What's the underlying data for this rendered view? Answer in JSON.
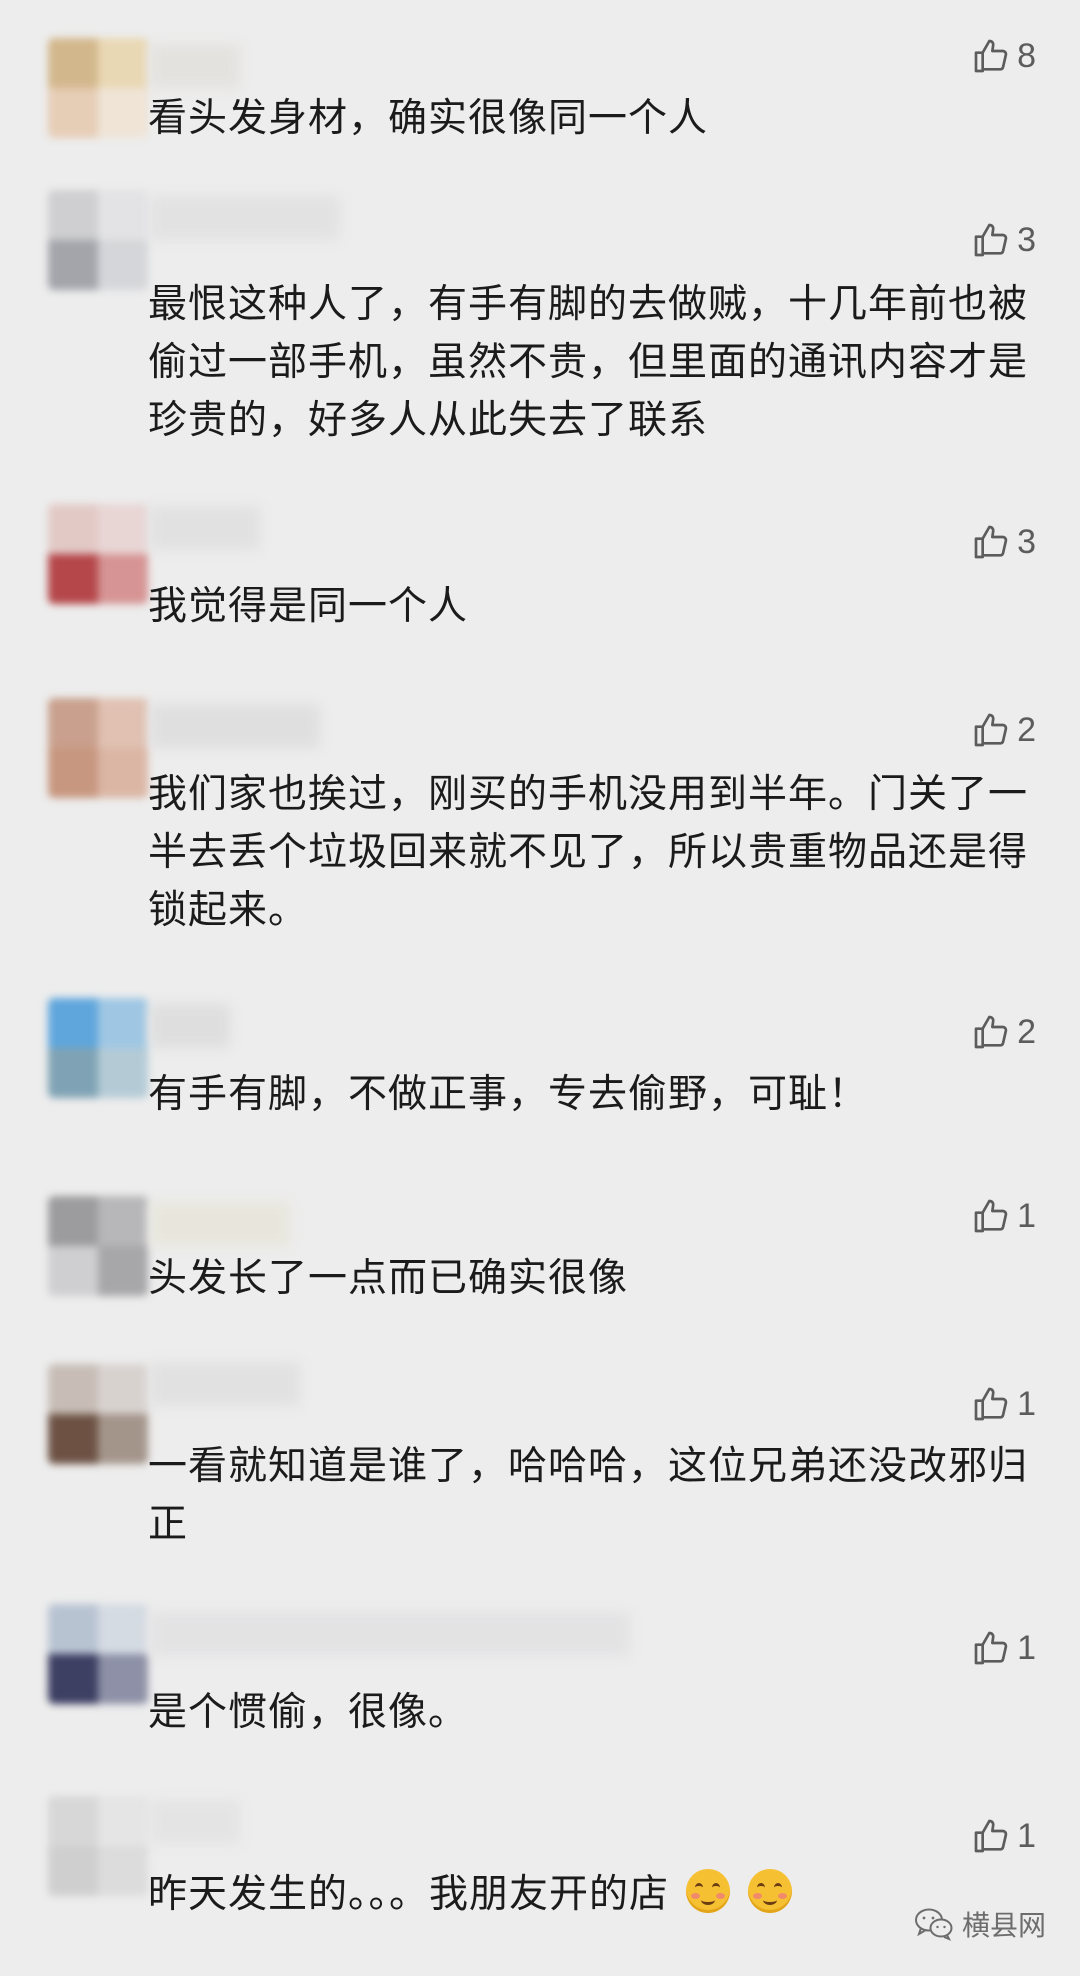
{
  "comments": [
    {
      "text": "看头发身材，确实很像同一个人",
      "likes": "8"
    },
    {
      "text": "最恨这种人了，有手有脚的去做贼，十几年前也被偷过一部手机，虽然不贵，但里面的通讯内容才是珍贵的，好多人从此失去了联系",
      "likes": "3"
    },
    {
      "text": "我觉得是同一个人",
      "likes": "3"
    },
    {
      "text": "我们家也挨过，刚买的手机没用到半年。门关了一半去丢个垃圾回来就不见了，所以贵重物品还是得锁起来。",
      "likes": "2"
    },
    {
      "text": "有手有脚，不做正事，专去偷野，可耻！",
      "likes": "2"
    },
    {
      "text": "头发长了一点而已确实很像",
      "likes": "1"
    },
    {
      "text": "一看就知道是谁了，哈哈哈，这位兄弟还没改邪归正",
      "likes": "1"
    },
    {
      "text": "是个惯偷，很像。",
      "likes": "1"
    },
    {
      "text": "昨天发生的。。。我朋友开的店",
      "likes": "1"
    }
  ],
  "watermark": {
    "label": "横县网"
  },
  "icons": {
    "like": "thumbs-up-icon",
    "emoji": "smile-emoji-icon",
    "wechat": "wechat-icon"
  }
}
